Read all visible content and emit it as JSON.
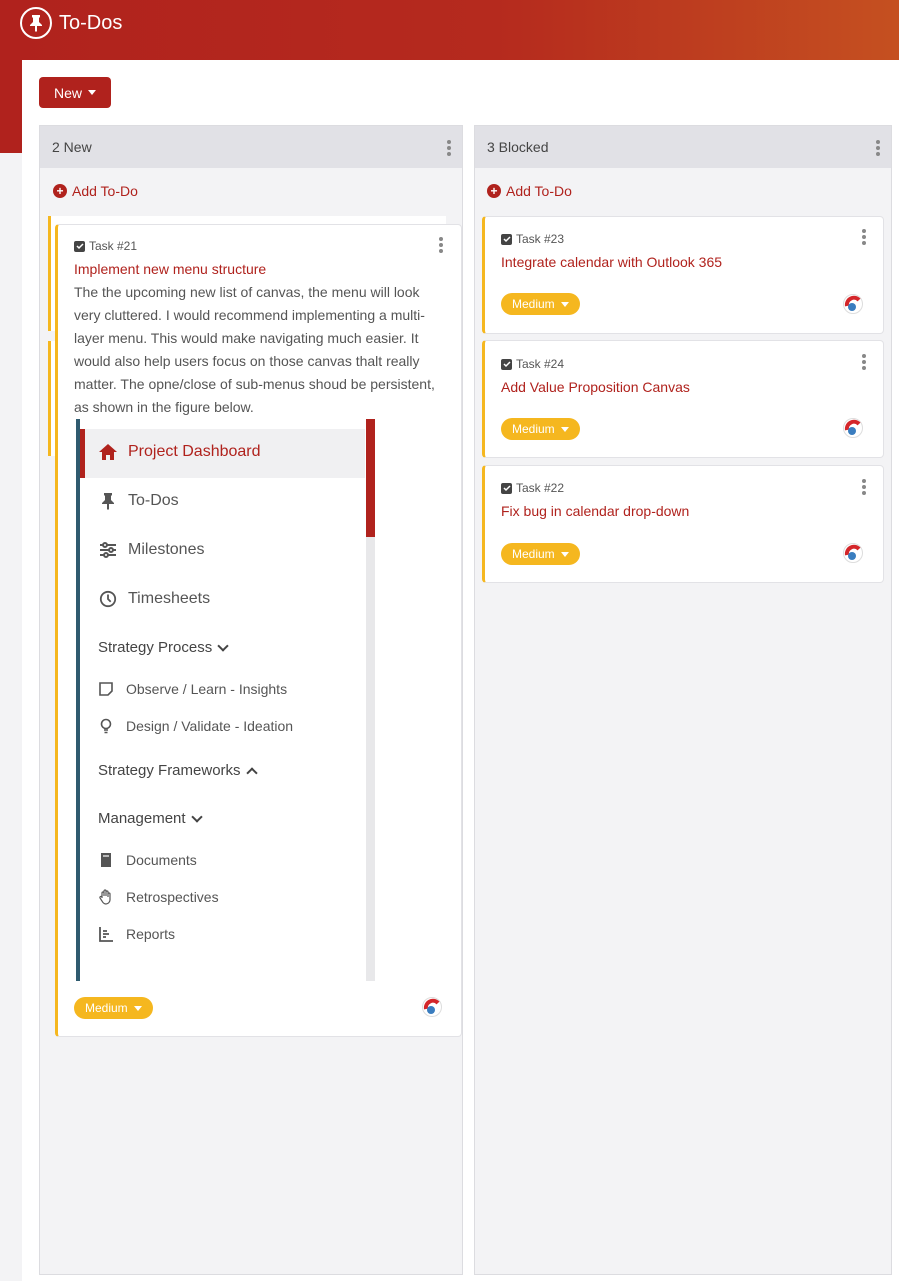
{
  "header": {
    "title": "To-Dos",
    "icon": "pin-icon"
  },
  "toolbar": {
    "new_label": "New"
  },
  "colors": {
    "brand": "#b0221d",
    "priority": "#f5b71f"
  },
  "columns": [
    {
      "title": "2 New",
      "add_label": "Add To-Do",
      "cards": [
        {
          "task_id": "Task #21",
          "title": "Implement new menu structure",
          "description": "The the upcoming new list of canvas, the menu will look very cluttered. I would recommend implementing a multi-layer menu. This would make navigating much easier. It would also help users focus on those canvas thalt really matter. The opne/close of sub-menus shoud be persistent, as shown in the figure below.",
          "priority": "Medium",
          "figure": {
            "items": [
              {
                "label": "Project Dashboard",
                "icon": "home-icon"
              },
              {
                "label": "To-Dos",
                "icon": "pin-icon"
              },
              {
                "label": "Milestones",
                "icon": "sliders-icon"
              },
              {
                "label": "Timesheets",
                "icon": "clock-icon"
              }
            ],
            "section1": "Strategy Process",
            "section1_items": [
              {
                "label": "Observe / Learn - Insights",
                "icon": "note-icon"
              },
              {
                "label": "Design / Validate - Ideation",
                "icon": "lightbulb-icon"
              }
            ],
            "section2": "Strategy Frameworks",
            "section3": "Management",
            "section3_items": [
              {
                "label": "Documents",
                "icon": "book-icon"
              },
              {
                "label": "Retrospectives",
                "icon": "hand-icon"
              },
              {
                "label": "Reports",
                "icon": "chart-icon"
              }
            ]
          }
        }
      ]
    },
    {
      "title": "3 Blocked",
      "add_label": "Add To-Do",
      "cards": [
        {
          "task_id": "Task #23",
          "title": "Integrate calendar with Outlook 365",
          "priority": "Medium"
        },
        {
          "task_id": "Task #24",
          "title": "Add Value Proposition Canvas",
          "priority": "Medium"
        },
        {
          "task_id": "Task #22",
          "title": "Fix bug in calendar drop-down",
          "priority": "Medium"
        }
      ]
    }
  ]
}
